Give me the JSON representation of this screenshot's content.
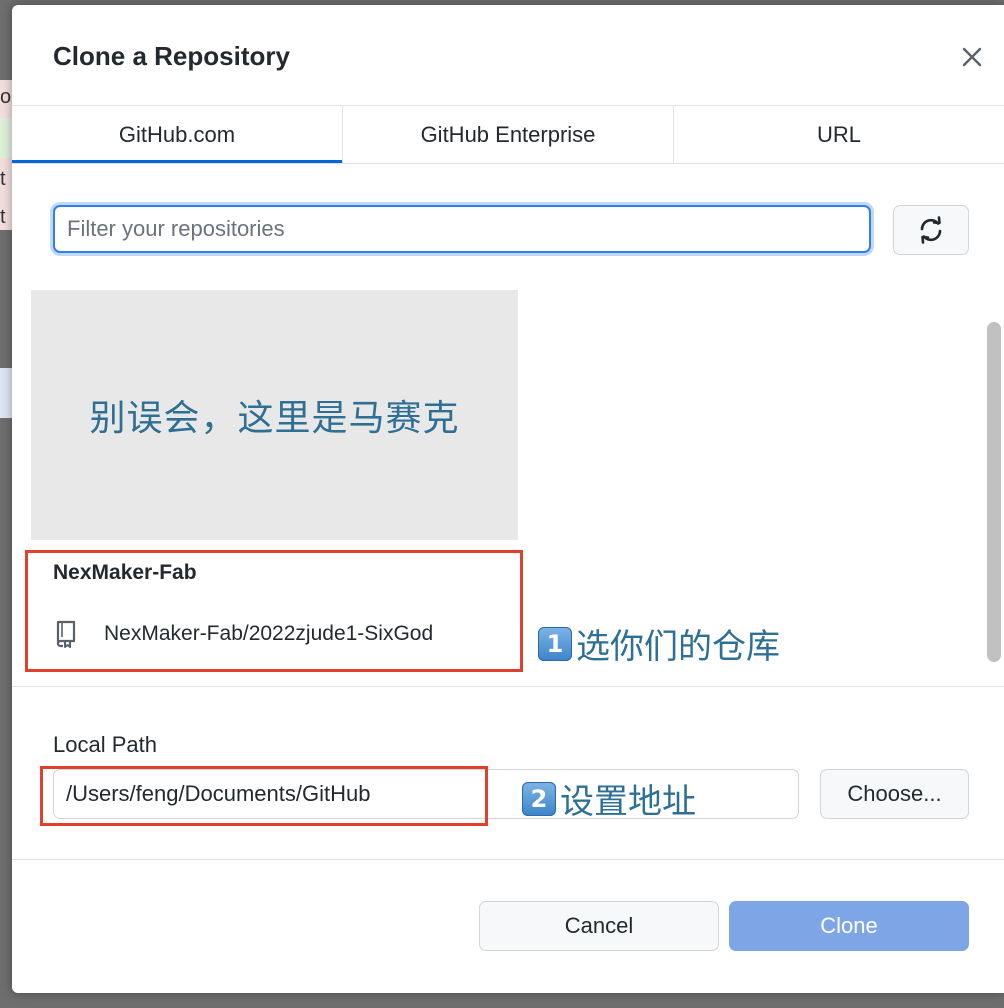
{
  "background_fragments": [
    "o,",
    "t",
    "t"
  ],
  "dialog": {
    "title": "Clone a Repository",
    "close_icon": "close-icon"
  },
  "tabs": [
    {
      "label": "GitHub.com",
      "selected": true
    },
    {
      "label": "GitHub Enterprise",
      "selected": false
    },
    {
      "label": "URL",
      "selected": false
    }
  ],
  "filter": {
    "placeholder": "Filter your repositories",
    "value": ""
  },
  "refresh_icon": "refresh-icon",
  "mosaic_text": "别误会，这里是马赛克",
  "repo_list": {
    "group_name": "NexMaker-Fab",
    "items": [
      {
        "icon": "repo-icon",
        "name": "NexMaker-Fab/2022zjude1-SixGod"
      }
    ]
  },
  "annotations": [
    {
      "badge": "1",
      "text": "选你们的仓库"
    },
    {
      "badge": "2",
      "text": "设置地址"
    }
  ],
  "local_path": {
    "label": "Local Path",
    "value": "/Users/feng/Documents/GitHub",
    "choose_label": "Choose..."
  },
  "buttons": {
    "cancel_label": "Cancel",
    "clone_label": "Clone"
  },
  "colors": {
    "accent": "#0366d6",
    "clone_button_disabled": "#7ea6e6",
    "annotation_box": "#e0412b",
    "annotation_text": "#2e6f94",
    "mosaic_bg": "#e8e8e8"
  }
}
